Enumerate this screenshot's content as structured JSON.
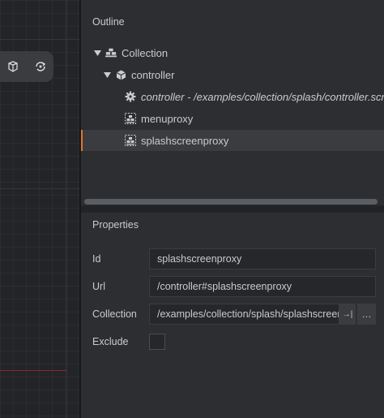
{
  "scene": {
    "toolbar": [
      {
        "icon": "perspective-icon"
      },
      {
        "icon": "realign-camera-icon"
      }
    ]
  },
  "outline": {
    "title": "Outline",
    "items": [
      {
        "label": "Collection",
        "icon": "collection-icon",
        "expanded": true
      },
      {
        "label": "controller",
        "icon": "game-object-icon",
        "expanded": true
      },
      {
        "label": "controller - /examples/collection/splash/controller.script",
        "icon": "script-gear-icon"
      },
      {
        "label": "menuproxy",
        "icon": "collection-proxy-icon"
      },
      {
        "label": "splashscreenproxy",
        "icon": "collection-proxy-icon",
        "selected": true
      }
    ]
  },
  "properties": {
    "title": "Properties",
    "id_label": "Id",
    "id_value": "splashscreenproxy",
    "url_label": "Url",
    "url_value": "/controller#splashscreenproxy",
    "collection_label": "Collection",
    "collection_value": "/examples/collection/splash/splashscreen.collection",
    "collection_open_symbol": "→|",
    "collection_browse_symbol": "…",
    "exclude_label": "Exclude",
    "exclude_checked": false
  },
  "colors": {
    "selection_accent": "#e0762f",
    "panel_bg": "#2c2e31",
    "scene_bg": "#232427"
  }
}
